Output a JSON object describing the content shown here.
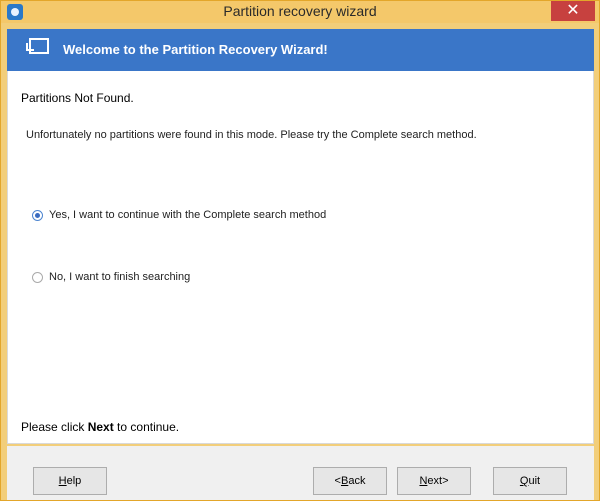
{
  "window": {
    "title": "Partition recovery wizard",
    "close_symbol": "✕"
  },
  "header": {
    "title": "Welcome to the Partition Recovery Wizard!"
  },
  "content": {
    "heading": "Partitions Not Found.",
    "description": "Unfortunately no partitions were found in this mode. Please try the Complete search method.",
    "options": [
      {
        "label": "Yes, I want to continue with the Complete search method",
        "checked": true
      },
      {
        "label": "No, I want to finish searching",
        "checked": false
      }
    ],
    "footer_text_prefix": "Please click ",
    "footer_text_bold": "Next",
    "footer_text_suffix": " to continue."
  },
  "buttons": {
    "help": {
      "access_key": "H",
      "rest": "elp"
    },
    "back": {
      "prefix": "<",
      "access_key": "B",
      "rest": "ack"
    },
    "next": {
      "access_key": "N",
      "rest": "ext>"
    },
    "quit": {
      "access_key": "Q",
      "rest": "uit"
    }
  },
  "colors": {
    "titlebar": "#f4c86a",
    "header_bg": "#3a76c8",
    "close_button": "#c7413f"
  },
  "icons": {
    "app": "app-icon",
    "header": "wizard-icon",
    "close": "close-icon"
  }
}
